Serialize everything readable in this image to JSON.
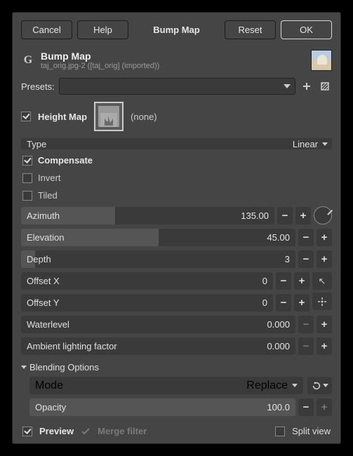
{
  "buttons": {
    "cancel": "Cancel",
    "help": "Help",
    "reset": "Reset",
    "ok": "OK"
  },
  "title": "Bump Map",
  "header": {
    "title": "Bump Map",
    "subtitle": "taj_orig.jpg-2 ([taj_orig] (imported))"
  },
  "presets_label": "Presets:",
  "heightmap": {
    "label": "Height Map",
    "value": "(none)",
    "checked": true
  },
  "type": {
    "label": "Type",
    "value": "Linear"
  },
  "compensate": {
    "label": "Compensate",
    "checked": true
  },
  "invert": {
    "label": "Invert",
    "checked": false
  },
  "tiled": {
    "label": "Tiled",
    "checked": false
  },
  "sliders": {
    "azimuth": {
      "label": "Azimuth",
      "value": "135.00",
      "fill": 37
    },
    "elevation": {
      "label": "Elevation",
      "value": "45.00",
      "fill": 50
    },
    "depth": {
      "label": "Depth",
      "value": "3",
      "fill": 5
    },
    "offsetx": {
      "label": "Offset X",
      "value": "0",
      "fill": 0
    },
    "offsety": {
      "label": "Offset Y",
      "value": "0",
      "fill": 0
    },
    "water": {
      "label": "Waterlevel",
      "value": "0.000",
      "fill": 0
    },
    "ambient": {
      "label": "Ambient lighting factor",
      "value": "0.000",
      "fill": 0
    }
  },
  "blend": {
    "header": "Blending Options",
    "mode_label": "Mode",
    "mode_value": "Replace",
    "opacity_label": "Opacity",
    "opacity_value": "100.0"
  },
  "bottom": {
    "preview": "Preview",
    "merge": "Merge filter",
    "split": "Split view",
    "preview_checked": true,
    "split_checked": false
  }
}
